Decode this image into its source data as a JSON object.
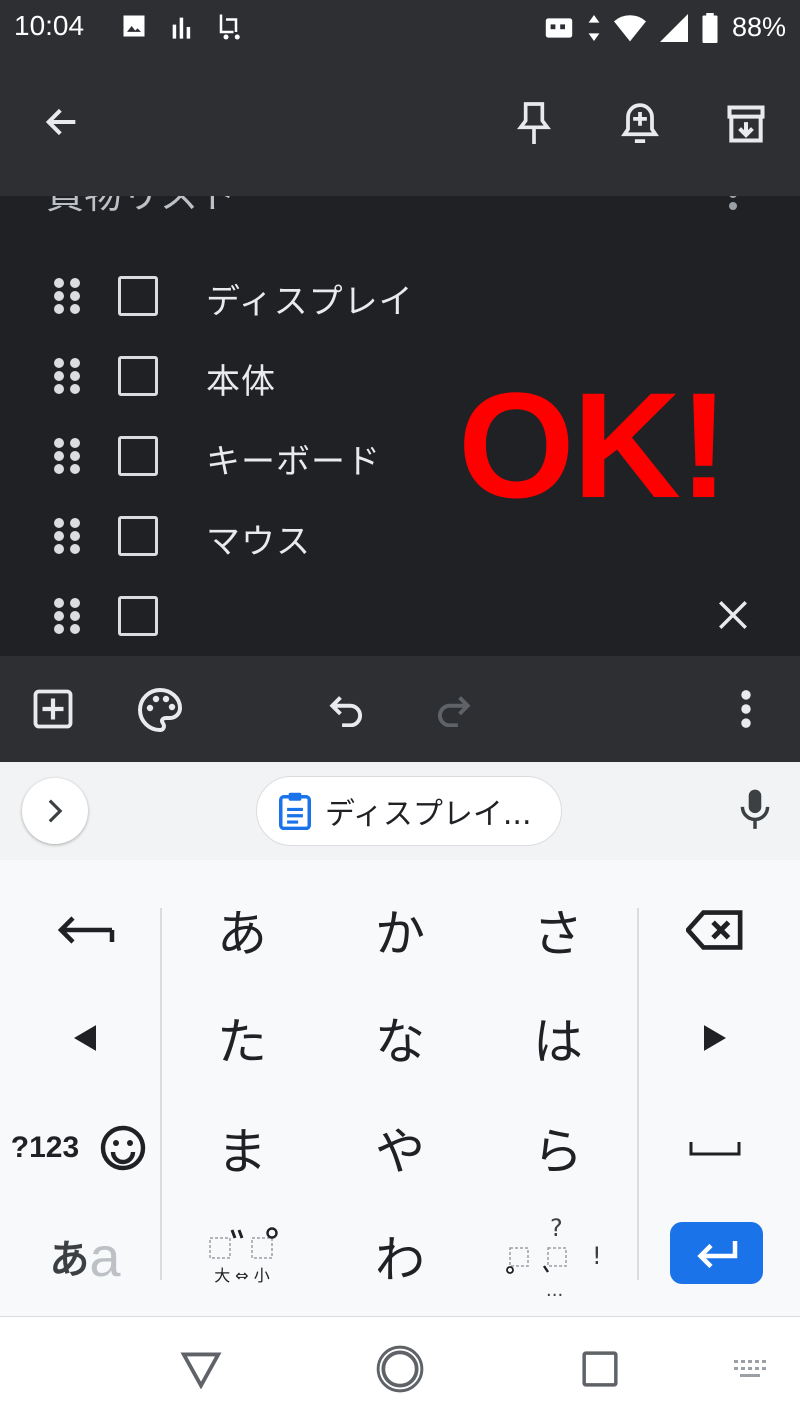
{
  "status": {
    "time": "10:04",
    "battery": "88%"
  },
  "note": {
    "title": "買物リスト",
    "items": [
      {
        "text": "ディスプレイ"
      },
      {
        "text": "本体"
      },
      {
        "text": "キーボード"
      },
      {
        "text": "マウス"
      },
      {
        "text": ""
      }
    ]
  },
  "overlay": {
    "text": "OK!",
    "color": "#ff0000"
  },
  "keyboard": {
    "suggestion_chip": "ディスプレイ...",
    "keys": {
      "row1": [
        "あ",
        "か",
        "さ"
      ],
      "row2": [
        "た",
        "な",
        "は"
      ],
      "row3": [
        "ま",
        "や",
        "ら"
      ],
      "row4_center": "わ",
      "numbers": "?123",
      "mode_a": "あ",
      "mode_b": "a",
      "dakuten_sub": "大 ⇔ 小",
      "punct_q": "?",
      "punct_ex": "!",
      "punct_more": "..."
    }
  },
  "colors": {
    "accent": "#1a73e8",
    "toolbar": "#2d2f33",
    "note_bg": "#202124"
  }
}
